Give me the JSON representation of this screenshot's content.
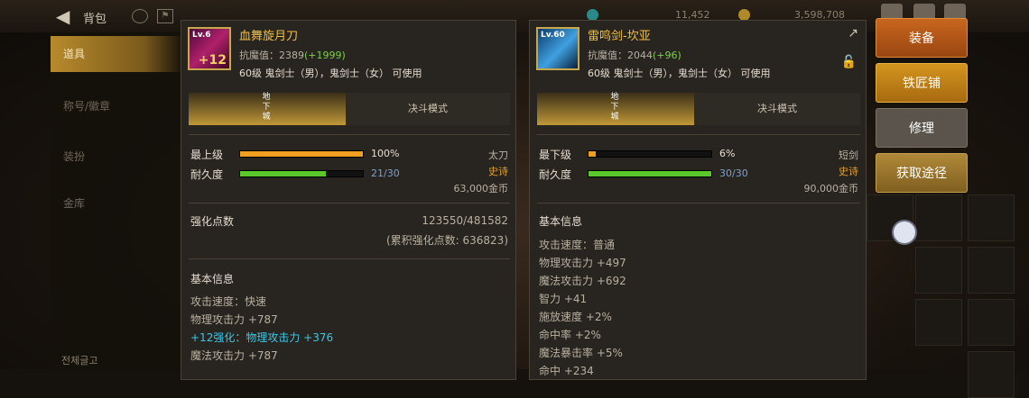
{
  "top": {
    "title": "背包",
    "currency1": "11,452",
    "currency2": "3,598,708"
  },
  "sidebar": {
    "items": [
      {
        "label": "道具"
      },
      {
        "label": "称号/徽章"
      },
      {
        "label": "装扮"
      },
      {
        "label": "金库"
      }
    ],
    "bottom": "전체글고"
  },
  "item1": {
    "thumb_lv": "Lv.6",
    "thumb_plus": "+12",
    "name": "血舞旋月刀",
    "resist_label": "抗魔值：2389",
    "resist_bonus": "(+1999)",
    "req": "60级 鬼剑士（男），鬼剑士（女） 可使用",
    "tab_on": "地下城",
    "tab_off": "决斗模式",
    "grade_label": "最上级",
    "grade_pct": "100%",
    "grade_fill": 1.0,
    "type": "太刀",
    "dur_label": "耐久度",
    "dur_val": "21/30",
    "dur_fill": 0.7,
    "rarity": "史诗",
    "price": "63,000金币",
    "reinforce_label": "强化点数",
    "reinforce_val": "123550/481582",
    "reinforce_total": "(累积强化点数: 636823)",
    "basic_title": "基本信息",
    "stats": [
      {
        "text": "攻击速度：快速",
        "color": "normal"
      },
      {
        "text": "物理攻击力 +787",
        "color": "normal"
      },
      {
        "text": "+12强化：物理攻击力 +376",
        "color": "cyan"
      },
      {
        "text": "魔法攻击力 +787",
        "color": "normal"
      }
    ]
  },
  "item2": {
    "thumb_lv": "Lv.60",
    "name": "雷鸣剑-坎亚",
    "resist_label": "抗魔值：2044",
    "resist_bonus": "(+96)",
    "req": "60级 鬼剑士（男），鬼剑士（女） 可使用",
    "tab_on": "地下城",
    "tab_off": "决斗模式",
    "grade_label": "最下级",
    "grade_pct": "6%",
    "grade_fill": 0.06,
    "type": "短剑",
    "dur_label": "耐久度",
    "dur_val": "30/30",
    "dur_fill": 1.0,
    "rarity": "史诗",
    "price": "90,000金币",
    "basic_title": "基本信息",
    "stats": [
      {
        "text": "攻击速度：普通",
        "color": "normal"
      },
      {
        "text": "物理攻击力 +497",
        "color": "normal"
      },
      {
        "text": "魔法攻击力 +692",
        "color": "normal"
      },
      {
        "text": "智力 +41",
        "color": "normal"
      },
      {
        "text": "施放速度 +2%",
        "color": "normal"
      },
      {
        "text": "命中率 +2%",
        "color": "normal"
      },
      {
        "text": "魔法暴击率 +5%",
        "color": "normal"
      },
      {
        "text": "命中 +234",
        "color": "normal"
      }
    ]
  },
  "buttons": {
    "equip": "装备",
    "smith": "铁匠铺",
    "repair": "修理",
    "source": "获取途径"
  },
  "colors": {
    "epic": "#e0a030",
    "grade_bar": "#f0a020",
    "dur_bar": "#5ac82a",
    "gold": "#f0c040"
  }
}
